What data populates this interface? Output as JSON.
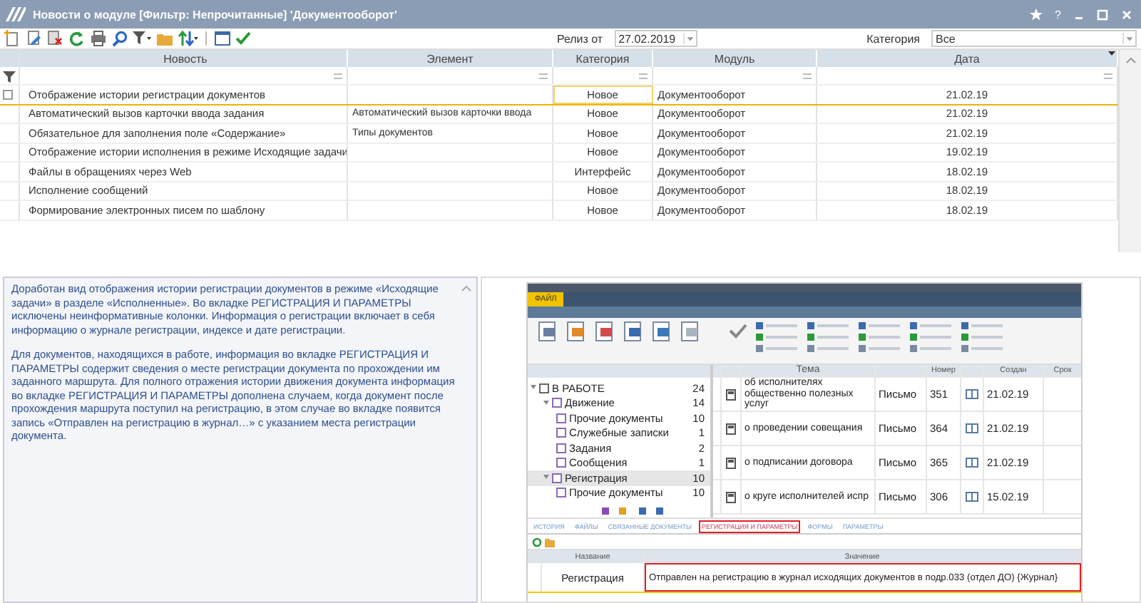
{
  "window": {
    "title": "Новости о модуле [Фильтр: Непрочитанные] 'Документооборот'",
    "help": "?"
  },
  "filters": {
    "release_label": "Релиз от",
    "release_date": "27.02.2019",
    "category_label": "Категория",
    "category_value": "Все"
  },
  "table": {
    "columns": [
      "Новость",
      "Элемент",
      "Категория",
      "Модуль",
      "Дата"
    ],
    "rows": [
      {
        "cells": [
          "Отображение истории регистрации документов",
          "",
          "Новое",
          "Документооборот",
          "21.02.19"
        ],
        "selected": true
      },
      {
        "cells": [
          "Автоматический вызов карточки ввода задания",
          "Автоматический вызов карточки ввода",
          "Новое",
          "Документооборот",
          "21.02.19"
        ],
        "selected": false
      },
      {
        "cells": [
          "Обязательное для заполнения поле «Содержание»",
          "Типы документов",
          "Новое",
          "Документооборот",
          "21.02.19"
        ],
        "selected": false
      },
      {
        "cells": [
          "Отображение истории исполнения в режиме Исходящие задачи",
          "",
          "Новое",
          "Документооборот",
          "19.02.19"
        ],
        "selected": false
      },
      {
        "cells": [
          "Файлы в обращениях через Web",
          "",
          "Интерфейс",
          "Документооборот",
          "18.02.19"
        ],
        "selected": false
      },
      {
        "cells": [
          "Исполнение сообщений",
          "",
          "Новое",
          "Документооборот",
          "18.02.19"
        ],
        "selected": false
      },
      {
        "cells": [
          "Формирование электронных писем по шаблону",
          "",
          "Новое",
          "Документооборот",
          "18.02.19"
        ],
        "selected": false
      }
    ]
  },
  "description": {
    "paragraphs": [
      "Доработан вид отображения истории регистрации документов в режиме «Исходящие задачи» в разделе «Исполненные». Во вкладке РЕГИСТРАЦИЯ И ПАРАМЕТРЫ исключены неинформативные колонки. Информация о регистрации включает в себя информацию о журнале регистрации, индексе и дате регистрации.",
      "Для документов, находящихся в работе, информация во вкладке РЕГИСТРАЦИЯ И ПАРАМЕТРЫ содержит сведения о месте регистрации документа по прохождении им заданного маршрута. Для полного отражения истории движения документа информация во вкладке РЕГИСТРАЦИЯ И ПАРАМЕТРЫ дополнена случаем, когда документ после прохождения маршрута поступил на регистрацию, в этом случае  во вкладке появится запись «Отправлен на регистрацию в журнал…» с указанием места регистрации документа."
    ]
  },
  "screenshot": {
    "menu": [
      {
        "label": "ФАЙЛ",
        "selected": true
      }
    ],
    "tree": [
      {
        "label": "В РАБОТЕ",
        "count": "24",
        "selected": false,
        "children": [
          {
            "label": "Движение",
            "count": "14",
            "selected": false,
            "children": [
              {
                "label": "Прочие документы",
                "count": "10",
                "selected": false
              },
              {
                "label": "Служебные записки",
                "count": "1",
                "selected": false
              },
              {
                "label": "Задания",
                "count": "2",
                "selected": false
              },
              {
                "label": "Сообщения",
                "count": "1",
                "selected": false
              }
            ]
          },
          {
            "label": "Регистрация",
            "count": "10",
            "selected": true,
            "children": [
              {
                "label": "Прочие документы",
                "count": "10",
                "selected": false
              }
            ]
          }
        ]
      }
    ],
    "documents": {
      "columns": {
        "subject": "Тема",
        "number": "Номер",
        "created": "Создан",
        "due": "Срок"
      },
      "rows": [
        {
          "subject": "об исполнителях общественно полезных услуг",
          "type": "Письмо",
          "number": "351",
          "date": "21.02.19"
        },
        {
          "subject": "о проведении совещания",
          "type": "Письмо",
          "number": "364",
          "date": "21.02.19"
        },
        {
          "subject": "о подписании договора",
          "type": "Письмо",
          "number": "365",
          "date": "21.02.19"
        },
        {
          "subject": "о круге исполнителей испр",
          "type": "Письмо",
          "number": "306",
          "date": "15.02.19"
        }
      ]
    },
    "tabs": [
      {
        "label": "ИСТОРИЯ",
        "selected": false
      },
      {
        "label": "ФАЙЛЫ",
        "selected": false
      },
      {
        "label": "СВЯЗАННЫЕ ДОКУМЕНТЫ",
        "selected": false
      },
      {
        "label": "РЕГИСТРАЦИЯ И ПАРАМЕТРЫ",
        "selected": true
      },
      {
        "label": "ФОРМЫ",
        "selected": false
      },
      {
        "label": "ПАРАМЕТРЫ",
        "selected": false
      }
    ],
    "parameters": {
      "columns": [
        "Название",
        "Значение"
      ],
      "rows": [
        {
          "name": "Регистрация",
          "value": "Отправлен на регистрацию в журнал исходящих документов в подр.033 (отдел ДО) {Журнал}",
          "highlighted": true
        }
      ]
    }
  }
}
